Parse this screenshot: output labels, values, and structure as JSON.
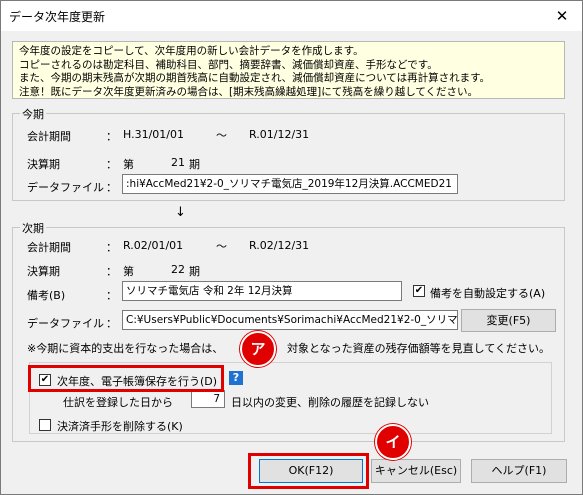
{
  "window": {
    "title": "データ次年度更新",
    "close_symbol": "✕"
  },
  "description": {
    "line1": "今年度の設定をコピーして、次年度用の新しい会計データを作成します。",
    "line2": "コピーされるのは勘定科目、補助科目、部門、摘要辞書、減価償却資産、手形などです。",
    "line3": "また、今期の期末残高が次期の期首残高に自動設定され、減価償却資産については再計算されます。",
    "line4": "注意！既にデータ次年度更新済みの場合は、[期末残高繰越処理]にて残高を繰り越してください。"
  },
  "current": {
    "group_label": "今期",
    "period_label": "会計期間",
    "colon": "：",
    "period_start": "H.31/01/01",
    "tilde": "～",
    "period_end": "R.01/12/31",
    "term_label": "決算期",
    "term_prefix": "第",
    "term_number": "21",
    "term_suffix": "期",
    "file_label": "データファイル",
    "file_value": ":hi¥AccMed21¥2-0_ソリマチ電気店_2019年12月決算.ACCMED21"
  },
  "arrow": "↓",
  "next": {
    "group_label": "次期",
    "period_label": "会計期間",
    "colon": "：",
    "period_start": "R.02/01/01",
    "tilde": "～",
    "period_end": "R.02/12/31",
    "term_label": "決算期",
    "term_prefix": "第",
    "term_number": "22",
    "term_suffix": "期",
    "memo_label": "備考(B)",
    "memo_value": "ソリマチ電気店 令和 2年 12月決算",
    "auto_memo_label": "備考を自動設定する(A)",
    "auto_memo_checked": true,
    "file_label": "データファイル",
    "file_value": "C:¥Users¥Public¥Documents¥Sorimachi¥AccMed21¥2-0_ソリマチ",
    "change_button": "変更(F5)"
  },
  "note_part1": "※今期に資本的支出を行なった場合は、",
  "note_part2": "対象となった資産の残存価額等を見直してください。",
  "options": {
    "ebook_label": "次年度、電子帳簿保存を行う(D)",
    "ebook_checked": true,
    "help_symbol": "?",
    "registration_prefix": "仕訳を登録した日から",
    "days_value": "7",
    "registration_suffix": "日以内の変更、削除の履歴を記録しない",
    "delete_bills_label": "決済済手形を削除する(K)",
    "delete_bills_checked": false
  },
  "buttons": {
    "ok": "OK(F12)",
    "cancel": "キャンセル(Esc)",
    "help": "ヘルプ(F1)"
  },
  "markers": {
    "a": "ア",
    "i": "イ"
  },
  "colors": {
    "highlight": "#e00000",
    "description_bg": "#ffffe1",
    "help_icon": "#1e73d2"
  }
}
